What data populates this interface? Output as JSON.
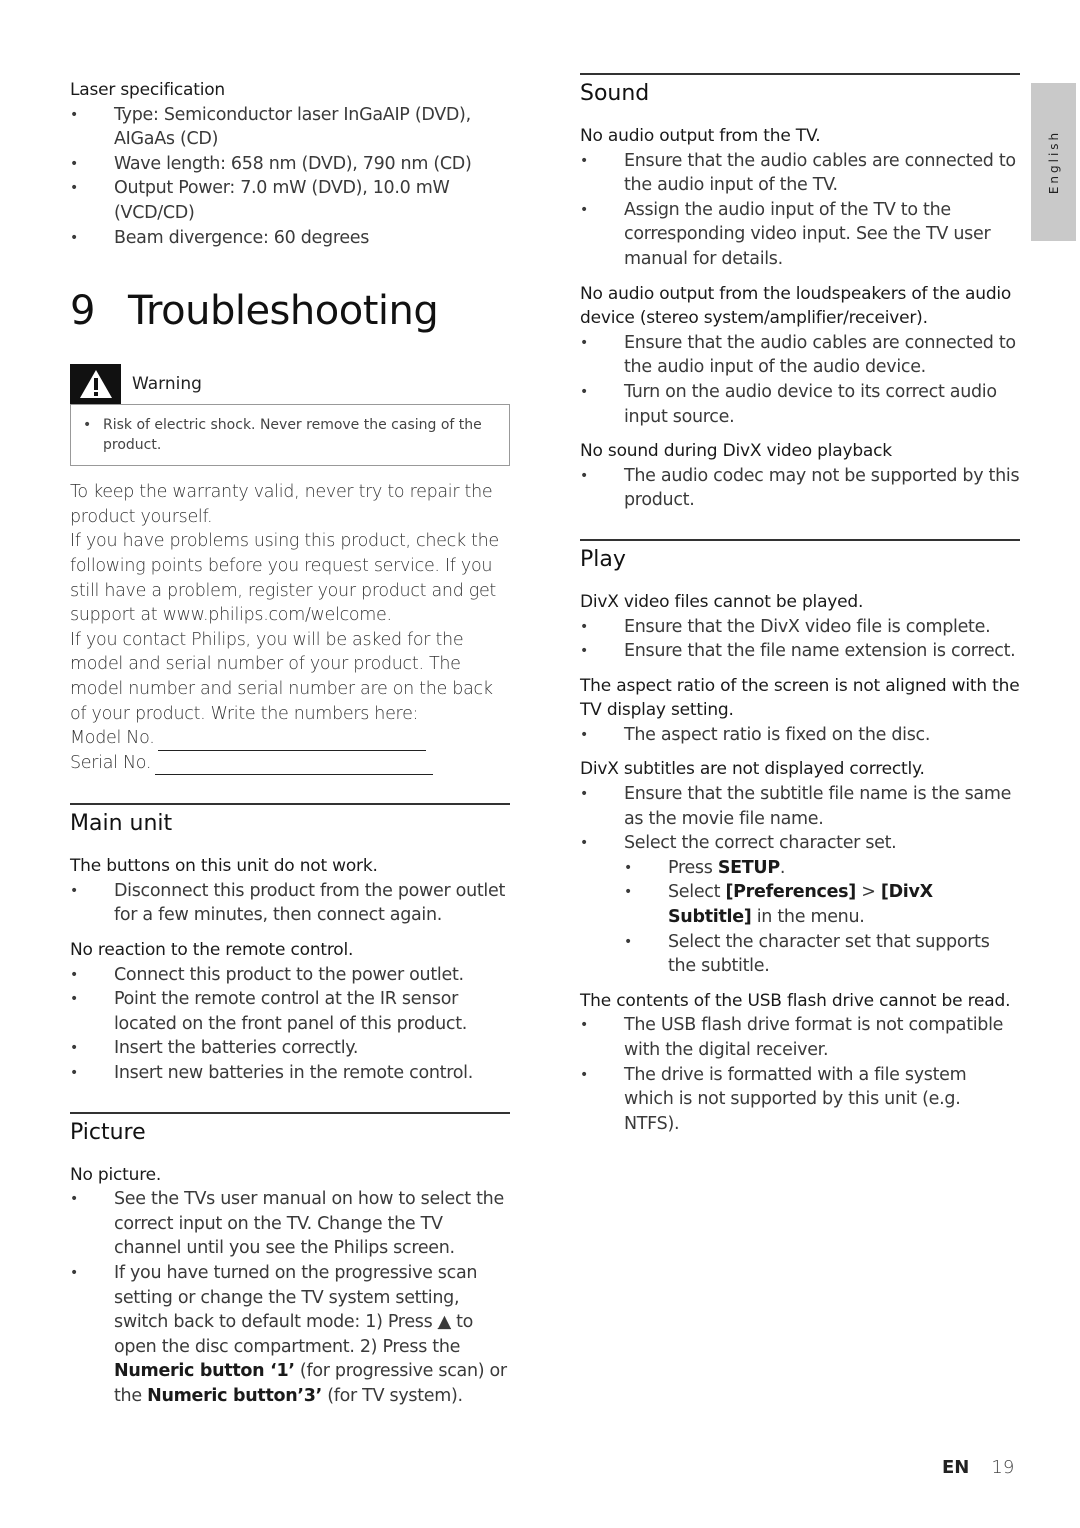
{
  "laser": {
    "title": "Laser specification",
    "items": [
      "Type: Semiconductor laser InGaAIP (DVD), AIGaAs (CD)",
      "Wave length: 658 nm (DVD), 790 nm (CD)",
      "Output Power: 7.0 mW (DVD), 10.0 mW (VCD/CD)",
      "Beam divergence: 60 degrees"
    ]
  },
  "chapter": {
    "number": "9",
    "title": "Troubleshooting"
  },
  "warning": {
    "icon": "warning-triangle-icon",
    "label": "Warning",
    "items": [
      "Risk of electric shock. Never remove the casing of the product."
    ]
  },
  "intro": {
    "p1": "To keep the warranty valid, never try to repair the product yourself.",
    "p2": "If you have problems using this product, check the following points before you request service. If you still have a problem, register your product and get support at www.philips.com/welcome.",
    "p3": "If you contact Philips, you will be asked for the model and serial number of your product. The model number and serial number are on the back of your product. Write the numbers here:",
    "model_label": "Model No.",
    "serial_label": "Serial No."
  },
  "main_unit": {
    "title": "Main unit",
    "problems": [
      {
        "q": "The buttons on this unit do not work.",
        "a": [
          "Disconnect this product from the power outlet for a few minutes, then connect again."
        ]
      },
      {
        "q": "No reaction to the remote control.",
        "a": [
          "Connect this product to the power outlet.",
          "Point the remote control at the IR sensor located on the front panel of this product.",
          "Insert the batteries correctly.",
          "Insert new batteries in the remote control."
        ]
      }
    ]
  },
  "picture": {
    "title": "Picture",
    "q": "No picture.",
    "a1": "See the TVs user manual on how to select the correct input on the TV. Change the TV channel until you see the Philips screen.",
    "a2_part1": "If you have turned on the progressive scan setting or change the TV system setting, switch back to default mode: 1) Press ",
    "eject_icon": "▲",
    "a2_part2": " to open the disc compartment. 2) Press the ",
    "a2_bold1": "Numeric button ‘1’",
    "a2_part3": " (for progressive scan) or the ",
    "a2_bold2": "Numeric button’3’",
    "a2_part4": " (for TV system)."
  },
  "sound": {
    "title": "Sound",
    "problems": [
      {
        "q": "No audio output from the TV.",
        "a": [
          "Ensure that the audio cables are connected to the audio input of the TV.",
          "Assign the audio input of the TV to the corresponding video input. See the TV user manual for details."
        ]
      },
      {
        "q": "No audio output from the loudspeakers of the audio device (stereo system/amplifier/receiver).",
        "a": [
          "Ensure that the audio cables are connected to the audio input of the audio device.",
          "Turn on the audio device to its correct audio input source."
        ]
      },
      {
        "q": "No sound during DivX video playback",
        "a": [
          "The audio codec may not be supported by this product."
        ]
      }
    ]
  },
  "play": {
    "title": "Play",
    "p1": {
      "q": "DivX video files cannot be played.",
      "a": [
        "Ensure that the DivX video file is complete.",
        "Ensure that the file name extension is correct."
      ]
    },
    "p2": {
      "q": "The aspect ratio of the screen is not aligned with the TV display setting.",
      "a": [
        "The aspect ratio is fixed on the disc."
      ]
    },
    "p3": {
      "q": "DivX subtitles are not displayed correctly.",
      "a1": "Ensure that the subtitle file name is the same as the movie file name.",
      "a2": "Select the correct character set.",
      "sub1_pre": "Press ",
      "sub1_bold": "SETUP",
      "sub1_post": ".",
      "sub2_pre": "Select ",
      "sub2_bold1": "[Preferences]",
      "sub2_mid": " > ",
      "sub2_bold2": "[DivX Subtitle]",
      "sub2_post": " in the menu.",
      "sub3": "Select the character set that supports the subtitle."
    },
    "p4": {
      "q": "The contents of the USB flash drive cannot be read.",
      "a": [
        "The USB flash drive format is not compatible with the digital receiver.",
        "The drive is formatted with a file system which is not supported by this unit (e.g. NTFS)."
      ]
    }
  },
  "side_tab": "English",
  "footer": {
    "lang": "EN",
    "page": "19"
  }
}
